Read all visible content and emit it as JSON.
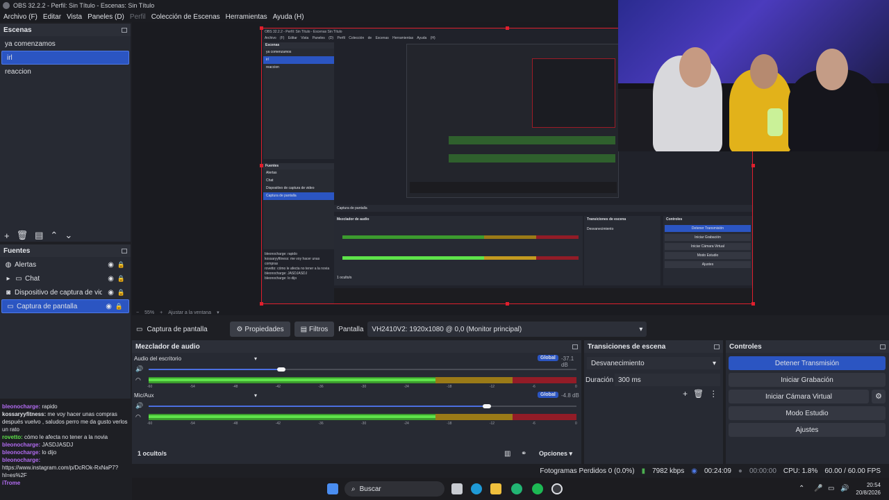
{
  "window": {
    "title": "OBS 32.2.2 - Perfil: Sin Título - Escenas: Sin Título"
  },
  "menu": [
    "Archivo (F)",
    "Editar",
    "Vista",
    "Paneles (D)",
    "Perfil",
    "Colección de Escenas",
    "Herramientas",
    "Ayuda (H)"
  ],
  "scenes": {
    "header": "Escenas",
    "items": [
      "ya comenzamos",
      "irl",
      "reaccion"
    ],
    "selected": 1
  },
  "sources": {
    "header": "Fuentes",
    "items": [
      {
        "label": "Alertas",
        "icon": "globe-icon"
      },
      {
        "label": "Chat",
        "icon": "folder-icon"
      },
      {
        "label": "Dispositivo de captura de video",
        "icon": "camera-icon"
      },
      {
        "label": "Captura de pantalla",
        "icon": "monitor-icon"
      }
    ],
    "selected": 3
  },
  "zoom": {
    "value": "55%",
    "fit": "Ajustar a la ventana"
  },
  "source_bar": {
    "name": "Captura de pantalla",
    "properties": "Propiedades",
    "filters": "Filtros",
    "display_label": "Pantalla",
    "display_value": "VH2410V2: 1920x1080 @ 0,0 (Monitor principal)"
  },
  "mixer": {
    "header": "Mezclador de audio",
    "channels": [
      {
        "name": "Audio del escritorio",
        "badge": "Global",
        "db": "-37.1 dB",
        "volume": 0.31,
        "level": 0.67
      },
      {
        "name": "Mic/Aux",
        "badge": "Global",
        "db": "-4.8 dB",
        "volume": 0.79,
        "level": 0.67
      }
    ],
    "ticks": [
      "-60",
      "-54",
      "-48",
      "-42",
      "-36",
      "-30",
      "-24",
      "-18",
      "-12",
      "-6",
      "0"
    ],
    "hidden": "1 oculto/s",
    "options": "Opciones"
  },
  "transitions": {
    "header": "Transiciones de escena",
    "selected": "Desvanecimiento",
    "duration_label": "Duración",
    "duration_value": "300 ms"
  },
  "controls": {
    "header": "Controles",
    "buttons": [
      "Detener Transmisión",
      "Iniciar Grabación",
      "Iniciar Cámara Virtual",
      "Modo Estudio",
      "Ajustes"
    ]
  },
  "status": {
    "dropped": "Fotogramas Perdidos 0 (0.0%)",
    "bitrate": "7982 kbps",
    "stream_time": "00:24:09",
    "rec_time": "00:00:00",
    "cpu": "CPU: 1.8%",
    "fps": "60.00 / 60.00 FPS"
  },
  "chat": [
    {
      "user": "bleonocharge:",
      "msg": "rapido",
      "color": "#b36cf2"
    },
    {
      "user": "kossaryyfitness:",
      "msg": "me voy hacer unas compras después vuelvo , saludos perro me da gusto verlos un rato",
      "color": "#dfe1e6"
    },
    {
      "user": "rovetto:",
      "msg": "cómo le afecta no tener a la novia",
      "color": "#5ee34a"
    },
    {
      "user": "bleonocharge:",
      "msg": "JASDJASDJ",
      "color": "#b36cf2"
    },
    {
      "user": "bleonocharge:",
      "msg": "lo dijo",
      "color": "#b36cf2"
    },
    {
      "user": "bleonocharge:",
      "msg": "https://www.instagram.com/p/DcROk-RxNaP7?hl=es%2F",
      "color": "#b36cf2"
    },
    {
      "user": "iTrome",
      "msg": "",
      "color": "#b36cf2"
    }
  ],
  "taskbar": {
    "search": "Buscar",
    "time": "20:54",
    "date": "20/8/2026"
  },
  "inner_preview": {
    "title": "OBS 32.2.2 - Perfil: Sin Título - Escenas Sin Título",
    "menu": "Archivo (F) Editar Vista Paneles (D) Perfil Colección de Escenas Herramientas Ayuda (H)"
  }
}
